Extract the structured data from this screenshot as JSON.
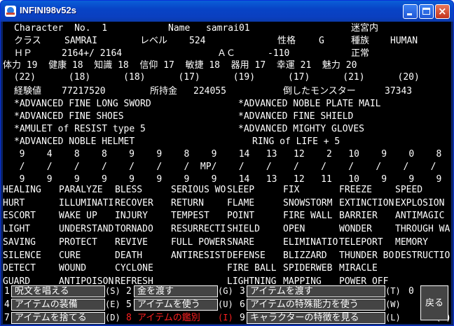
{
  "window": {
    "title": "INFINI98v52s"
  },
  "status": {
    "character_no_label": "Character  No.  1",
    "name_label": "Name",
    "name": "samrai01",
    "maze_label": "迷宮内",
    "class_label": "クラス",
    "class": "SAMRAI",
    "level_label": "レベル",
    "level": "524",
    "alignment_label": "性格",
    "alignment": "G",
    "race_label": "種族",
    "race": "HUMAN",
    "hp_label": "ＨＰ",
    "hp": "2164+/ 2164",
    "ac_label": "ＡＣ",
    "ac": "-110",
    "condition": "正常",
    "stats_row": "体力 19  健康 18  知識 18  信仰 17  敏捷 18  器用 17  幸運 21  魅力 20",
    "stats_max_row": "  (22)      (18)      (18)      (17)      (19)      (17)      (21)      (20)",
    "exp_label": "経験値",
    "exp": "77217520",
    "gold_label": "所持金",
    "gold": "224055",
    "kills_label": "倒したモンスター",
    "kills": "37343"
  },
  "equipment": [
    "*ADVANCED FINE LONG SWORD",
    "*ADVANCED NOBLE PLATE MAIL",
    "*ADVANCED FINE SHOES",
    "*ADVANCED FINE SHIELD",
    "*AMULET of RESIST type 5",
    "*ADVANCED MIGHTY GLOVES",
    "*ADVANCED NOBLE HELMET",
    "RING of LIFE + 5"
  ],
  "mp": {
    "current_row": "  9    4    8    8    9    9    8    9    14   13   12    2   10    9    0    8",
    "slash_row": "  /    /    /    /    /    /    /  MP/    /    /    /    /    /    /    /    /",
    "max_row": "  9    9    9    9    9    9    9    9    14   13   12   11   10    9    9    9"
  },
  "spells": [
    [
      "HEALING",
      "PARALYZE",
      "BLESS",
      "SERIOUS WO",
      "SLEEP",
      "FIX",
      "FREEZE",
      "SPEED"
    ],
    [
      "HURT",
      "ILLUMINATI",
      "RECOVER",
      "RETURN",
      "FLAME",
      "SNOWSTORM",
      "EXTINCTION",
      "EXPLOSION"
    ],
    [
      "ESCORT",
      "WAKE UP",
      "INJURY",
      "TEMPEST",
      "POINT",
      "FIRE WALL",
      "BARRIER",
      "ANTIMAGIC"
    ],
    [
      "LIGHT",
      "UNDERSTAND",
      "TORNADO",
      "RESURRECTI",
      "SHIELD",
      "OPEN",
      "WONDER",
      "THROUGH WA"
    ],
    [
      "SAVING",
      "PROTECT",
      "REVIVE",
      "FULL POWER",
      "SNARE",
      "ELIMINATIO",
      "TELEPORT",
      "MEMORY"
    ],
    [
      "SILENCE",
      "CURE",
      "DEATH",
      "ANTIRESIST",
      "DEFENSE",
      "BLIZZARD",
      "THUNDER BO",
      "DESTRUCTIO"
    ],
    [
      "DETECT",
      "WOUND",
      "CYCLONE",
      "",
      "FIRE BALL",
      "SPIDERWEB",
      "MIRACLE",
      ""
    ],
    [
      "GUARD",
      "ANTIPOISON",
      "REFRESH",
      "",
      "LIGHTNING",
      "MAPPING",
      "POWER OFF",
      ""
    ]
  ],
  "menu": [
    {
      "num": "1",
      "label": "呪文を唱える",
      "key": "(S)",
      "color": "#ffffff"
    },
    {
      "num": "2",
      "label": "金を渡す",
      "key": "(G)",
      "color": "#ffffff"
    },
    {
      "num": "3",
      "label": "アイテムを渡す",
      "key": "(T)",
      "color": "#ffffff"
    },
    {
      "num": "4",
      "label": "アイテムの装備",
      "key": "(E)",
      "color": "#ffffff"
    },
    {
      "num": "5",
      "label": "アイテムを使う",
      "key": "(U)",
      "color": "#ffffff"
    },
    {
      "num": "6",
      "label": "アイテムの特殊能力を使う",
      "key": "(W)",
      "color": "#ffffff"
    },
    {
      "num": "7",
      "label": "アイテムを捨てる",
      "key": "(D)",
      "color": "#ffffff"
    },
    {
      "num": "8",
      "label": "アイテムの鑑別",
      "key": "(I)",
      "color": "#ff2020"
    },
    {
      "num": "9",
      "label": "キャラクターの特徴を見る",
      "key": "(L)",
      "color": "#ffffff"
    },
    {
      "num": "0",
      "label": "戻る",
      "key": "(B)",
      "color": "#ffffff"
    }
  ]
}
